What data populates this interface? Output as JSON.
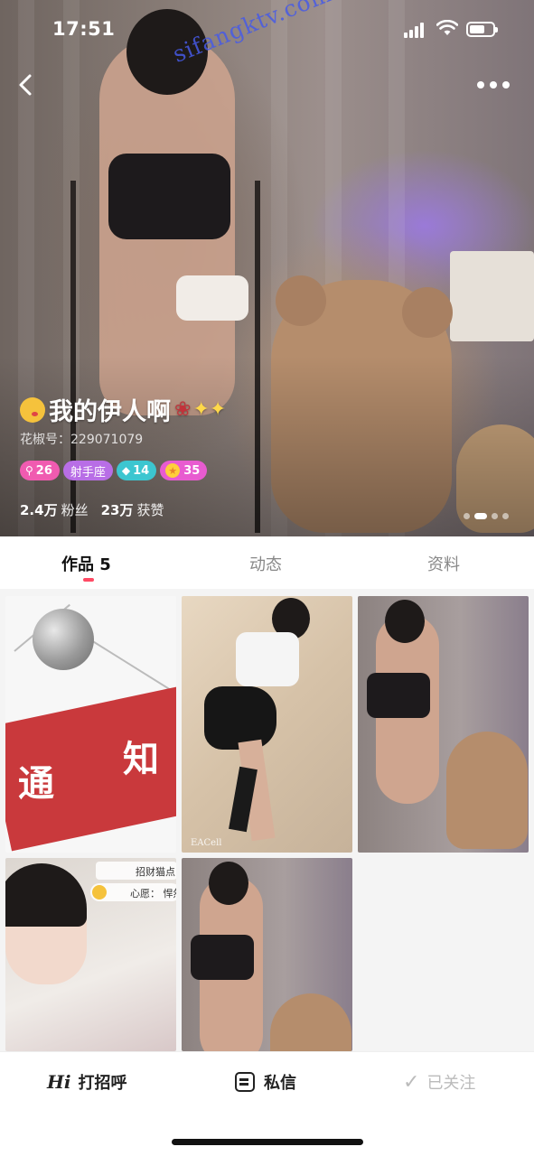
{
  "status_bar": {
    "time": "17:51"
  },
  "watermark": "sifangktv.com",
  "profile": {
    "name": "我的伊人啊",
    "huajiao_id": "花椒号：229071079",
    "badges": {
      "level": "26",
      "zodiac": "射手座",
      "diamond": "14",
      "star": "35"
    },
    "stats": {
      "fans_value": "2.4万",
      "fans_label": "粉丝",
      "likes_value": "23万",
      "likes_label": "获赞"
    },
    "pager": {
      "total": 4,
      "active_index": 1
    }
  },
  "tabs": [
    {
      "label": "作品 5",
      "active": true
    },
    {
      "label": "动态",
      "active": false
    },
    {
      "label": "资料",
      "active": false
    }
  ],
  "grid": {
    "tile1": {
      "char1": "通",
      "char2": "知"
    },
    "tile2": {
      "mark": "EACell"
    },
    "tile4": {
      "label1": "招财猫点",
      "label2": "心愿：  悍然"
    }
  },
  "bottom_bar": {
    "greet_icon": "Hi",
    "greet_label": "打招呼",
    "message_label": "私信",
    "follow_label": "已关注"
  },
  "colors": {
    "accent": "#ff4a64",
    "badge_level": "#f05bb0",
    "badge_zodiac": "#b86ee6",
    "badge_diamond": "#3cc6d0",
    "badge_star": "#e85bd0"
  }
}
